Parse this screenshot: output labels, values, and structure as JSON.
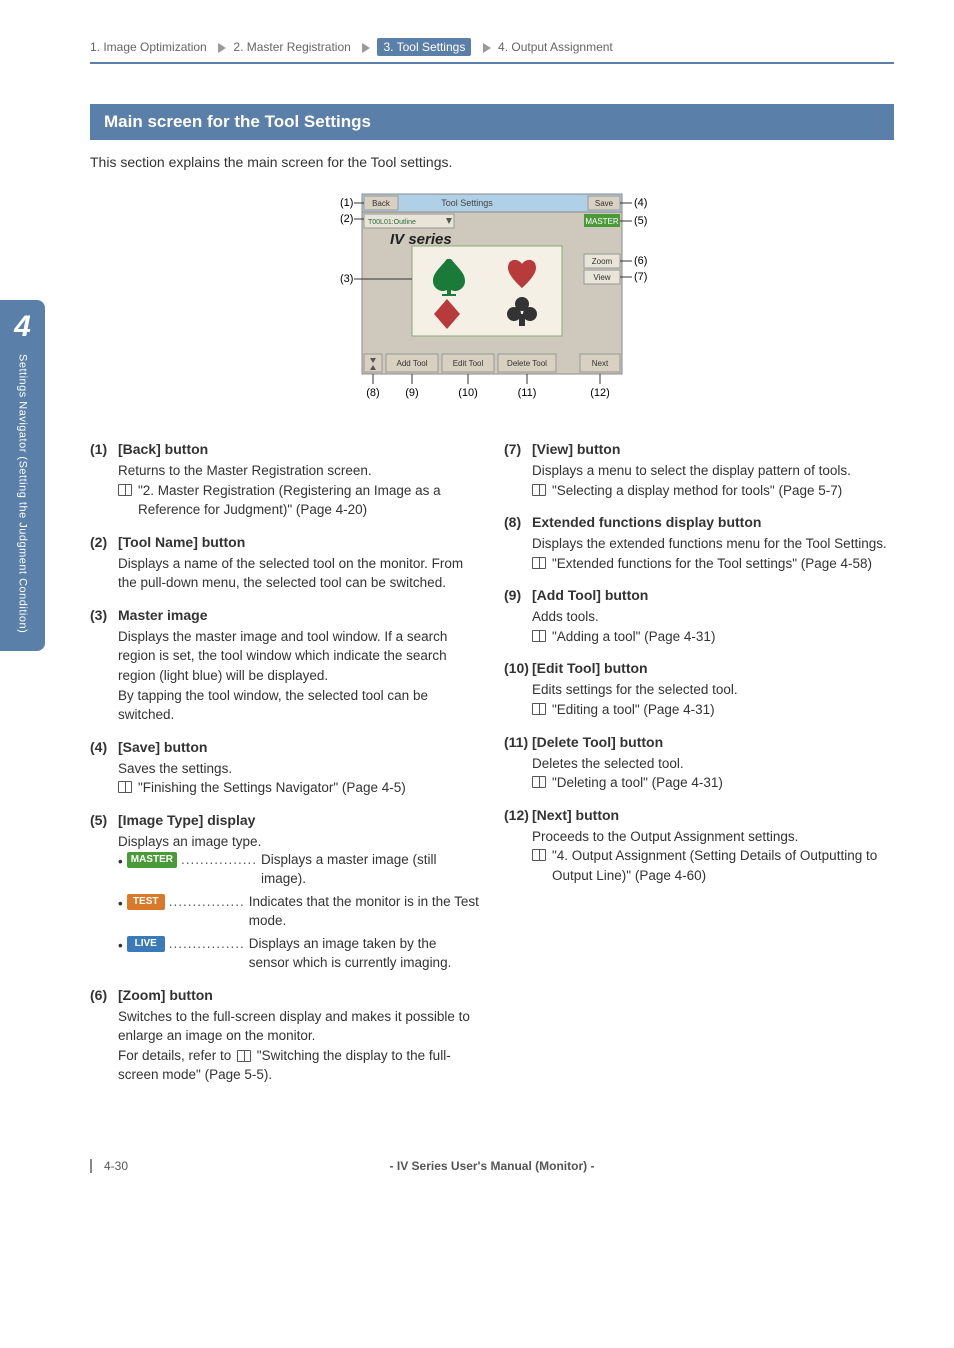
{
  "breadcrumb": {
    "items": [
      "1. Image Optimization",
      "2. Master Registration",
      "3. Tool Settings",
      "4. Output Assignment"
    ],
    "current_index": 2
  },
  "chapter": {
    "number": "4",
    "label": "Settings Navigator (Setting the Judgment Condition)"
  },
  "section_title": "Main screen for the Tool Settings",
  "intro_text": "This section explains the main screen for the Tool settings.",
  "figure": {
    "callouts": [
      "(1)",
      "(2)",
      "(3)",
      "(4)",
      "(5)",
      "(6)",
      "(7)",
      "(8)",
      "(9)",
      "(10)",
      "(11)",
      "(12)"
    ],
    "ui": {
      "back": "Back",
      "title": "Tool Settings",
      "tool_name": "T00L01:Outline",
      "brand": "IV series",
      "save": "Save",
      "master": "MASTER",
      "zoom": "Zoom",
      "view": "View",
      "add": "Add Tool",
      "edit": "Edit Tool",
      "delete": "Delete Tool",
      "next": "Next"
    }
  },
  "left_items": [
    {
      "num": "(1)",
      "title": "[Back] button",
      "desc": "Returns to the Master Registration screen.",
      "refs": [
        "\"2. Master Registration (Registering an Image as a Reference for Judgment)\" (Page 4-20)"
      ]
    },
    {
      "num": "(2)",
      "title": "[Tool Name] button",
      "desc": "Displays a name of the selected tool on the monitor. From the pull-down menu, the selected tool can be switched."
    },
    {
      "num": "(3)",
      "title": "Master image",
      "desc": "Displays the master image and tool window. If a search region is set, the tool window which indicate the search region (light blue) will be displayed.\nBy tapping the tool window, the selected tool can be switched."
    },
    {
      "num": "(4)",
      "title": "[Save] button",
      "desc": "Saves the settings.",
      "refs": [
        "\"Finishing the Settings Navigator\" (Page 4-5)"
      ]
    },
    {
      "num": "(5)",
      "title": "[Image Type] display",
      "desc": "Displays an image type.",
      "bullets": [
        {
          "badge": "MASTER",
          "badge_cls": "badge-green",
          "text": "Displays a master image (still image)."
        },
        {
          "badge": "TEST",
          "badge_cls": "badge-orange",
          "text": "Indicates that the monitor is in the Test mode."
        },
        {
          "badge": "LIVE",
          "badge_cls": "badge-blue",
          "text": "Displays an image taken by the sensor which is currently imaging."
        }
      ]
    },
    {
      "num": "(6)",
      "title": "[Zoom] button",
      "desc_parts": [
        "Switches to the full-screen display and makes it possible to enlarge an image on the monitor.",
        "For details, refer to ",
        " \"Switching the display to the full-screen mode\" (Page 5-5)."
      ]
    }
  ],
  "right_items": [
    {
      "num": "(7)",
      "title": "[View] button",
      "desc": "Displays a menu to select the display pattern of tools.",
      "refs": [
        "\"Selecting a display method for tools\" (Page 5-7)"
      ]
    },
    {
      "num": "(8)",
      "title": "Extended functions display button",
      "desc": "Displays the extended functions menu for the Tool Settings.",
      "refs": [
        "\"Extended functions for the Tool settings\" (Page 4-58)"
      ]
    },
    {
      "num": "(9)",
      "title": "[Add Tool] button",
      "desc": "Adds tools.",
      "refs": [
        "\"Adding a tool\" (Page 4-31)"
      ]
    },
    {
      "num": "(10)",
      "title": "[Edit Tool] button",
      "desc": "Edits settings for the selected tool.",
      "refs": [
        "\"Editing a tool\" (Page 4-31)"
      ]
    },
    {
      "num": "(11)",
      "title": "[Delete Tool] button",
      "desc": "Deletes the selected tool.",
      "refs": [
        "\"Deleting a tool\" (Page 4-31)"
      ]
    },
    {
      "num": "(12)",
      "title": "[Next] button",
      "desc": "Proceeds to the Output Assignment settings.",
      "refs": [
        "\"4. Output Assignment (Setting Details of Outputting to Output Line)\" (Page 4-60)"
      ]
    }
  ],
  "footer": {
    "page_number": "4-30",
    "title": "- IV Series User's Manual (Monitor) -"
  },
  "dots": "................"
}
